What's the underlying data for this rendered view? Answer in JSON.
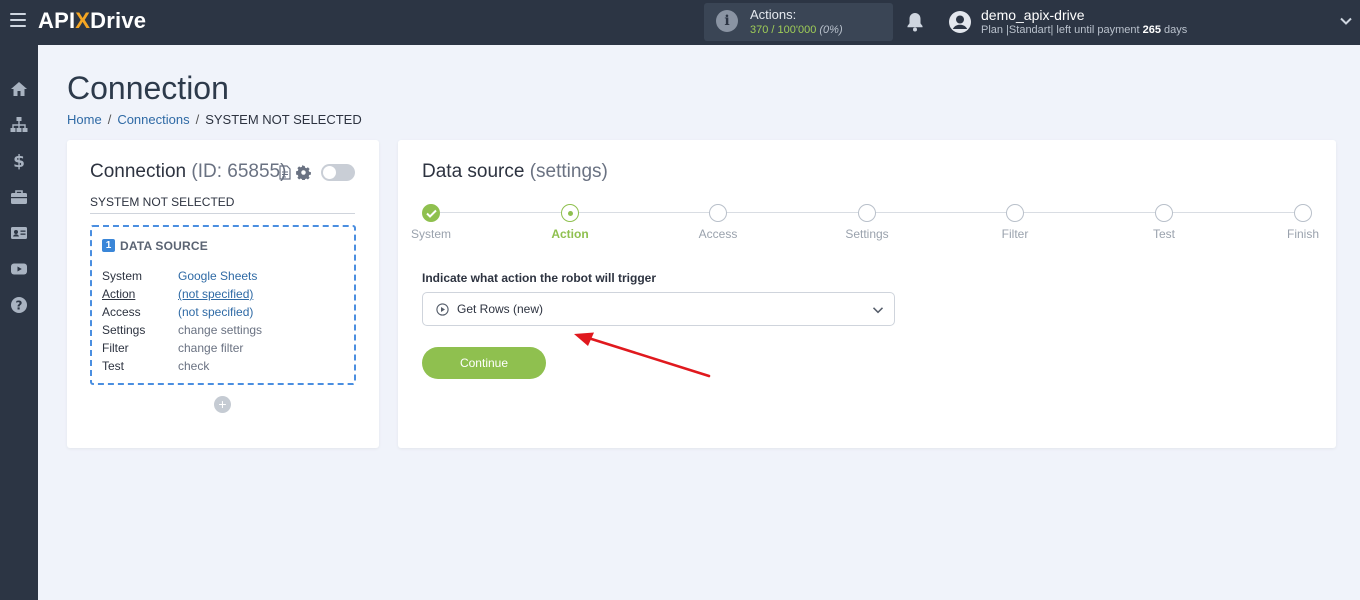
{
  "app": {
    "logo_prefix": "API",
    "logo_x": "X",
    "logo_suffix": "Drive"
  },
  "header": {
    "actions_label": "Actions:",
    "actions_value": "370 / 100'000",
    "actions_pct": "(0%)",
    "user_name": "demo_apix-drive",
    "plan_prefix": "Plan |Standart| left until payment ",
    "plan_days": "265",
    "plan_suffix": " days"
  },
  "sidebar": {
    "items": [
      "home-icon",
      "sitemap-icon",
      "dollar-icon",
      "briefcase-icon",
      "id-card-icon",
      "youtube-icon",
      "help-icon"
    ]
  },
  "page": {
    "title": "Connection",
    "breadcrumb": [
      "Home",
      "Connections",
      "SYSTEM NOT SELECTED"
    ]
  },
  "connection": {
    "title": "Connection",
    "id_label": "(ID: 65855)",
    "system_name": "SYSTEM NOT SELECTED",
    "source_number": "1",
    "source_title": "DATA SOURCE",
    "rows": [
      {
        "key": "System",
        "value": "Google Sheets"
      },
      {
        "key": "Action",
        "value": "(not specified)"
      },
      {
        "key": "Access",
        "value": "(not specified)"
      },
      {
        "key": "Settings",
        "value": "change settings"
      },
      {
        "key": "Filter",
        "value": "change filter"
      },
      {
        "key": "Test",
        "value": "check"
      }
    ],
    "add_label": "+"
  },
  "data_source": {
    "heading": "Data source",
    "heading_muted": "(settings)",
    "steps": [
      "System",
      "Action",
      "Access",
      "Settings",
      "Filter",
      "Test",
      "Finish"
    ],
    "active_step": "Action",
    "field_label": "Indicate what action the robot will trigger",
    "selected_action": "Get Rows (new)",
    "continue_label": "Continue"
  },
  "colors": {
    "accent_green": "#8fc04f",
    "link_blue": "#2f6aa5",
    "topbar": "#2c3544",
    "annotation_arrow": "#e0191e"
  }
}
